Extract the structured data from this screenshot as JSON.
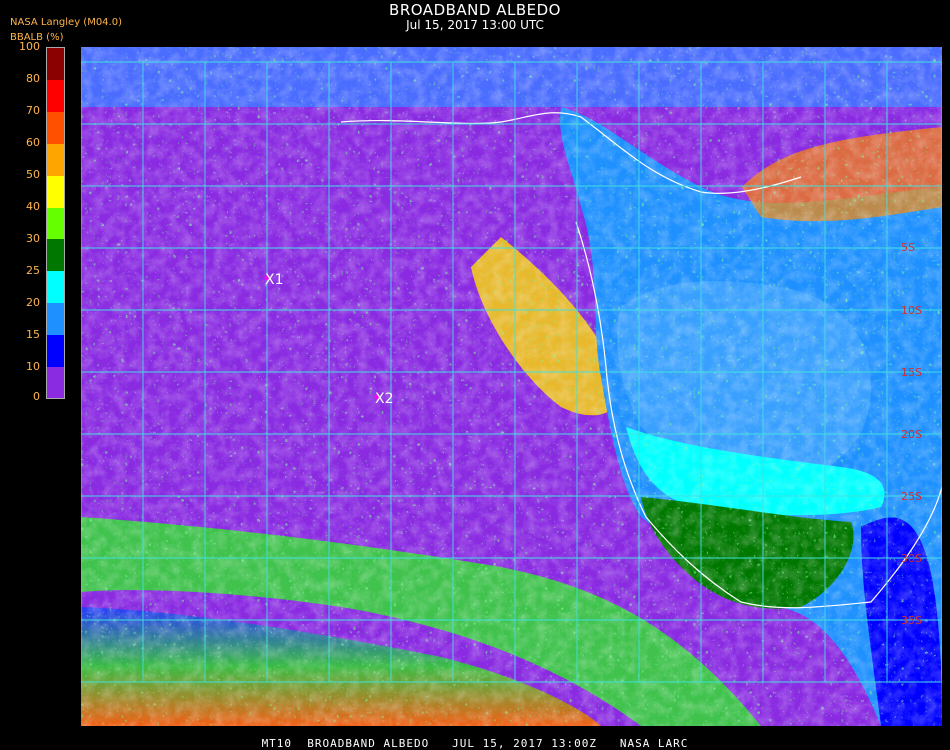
{
  "header": {
    "title": "BROADBAND ALBEDO",
    "subtitle": "Jul 15, 2017 13:00 UTC",
    "source": "NASA Langley (M04.0)",
    "unit": "BBALB (%)"
  },
  "colorbar": {
    "ticks": [
      "100",
      "80",
      "70",
      "60",
      "50",
      "40",
      "30",
      "25",
      "20",
      "15",
      "10",
      "0"
    ],
    "bins": [
      {
        "from": 0,
        "to": 10,
        "color": "#8a2be2"
      },
      {
        "from": 10,
        "to": 15,
        "color": "#0000ff"
      },
      {
        "from": 15,
        "to": 20,
        "color": "#1e90ff"
      },
      {
        "from": 20,
        "to": 25,
        "color": "#00ffff"
      },
      {
        "from": 25,
        "to": 30,
        "color": "#007800"
      },
      {
        "from": 30,
        "to": 40,
        "color": "#66ff00"
      },
      {
        "from": 40,
        "to": 50,
        "color": "#ffff00"
      },
      {
        "from": 50,
        "to": 60,
        "color": "#ffa500"
      },
      {
        "from": 60,
        "to": 70,
        "color": "#ff5000"
      },
      {
        "from": 70,
        "to": 80,
        "color": "#ff0000"
      },
      {
        "from": 80,
        "to": 100,
        "color": "#8b0000"
      }
    ]
  },
  "map": {
    "lat_labels": [
      "5S",
      "10S",
      "15S",
      "20S",
      "25S",
      "30S",
      "35S"
    ],
    "markers": [
      {
        "label": "X1"
      },
      {
        "label": "X2"
      }
    ],
    "colors": {
      "ocean": "#8a2be2",
      "grid": "#40e0e0",
      "coast": "#ffffff",
      "lat_label": "#d03030"
    }
  },
  "footer": {
    "text": "MT10  BROADBAND ALBEDO   JUL 15, 2017 13:00Z   NASA LARC"
  }
}
